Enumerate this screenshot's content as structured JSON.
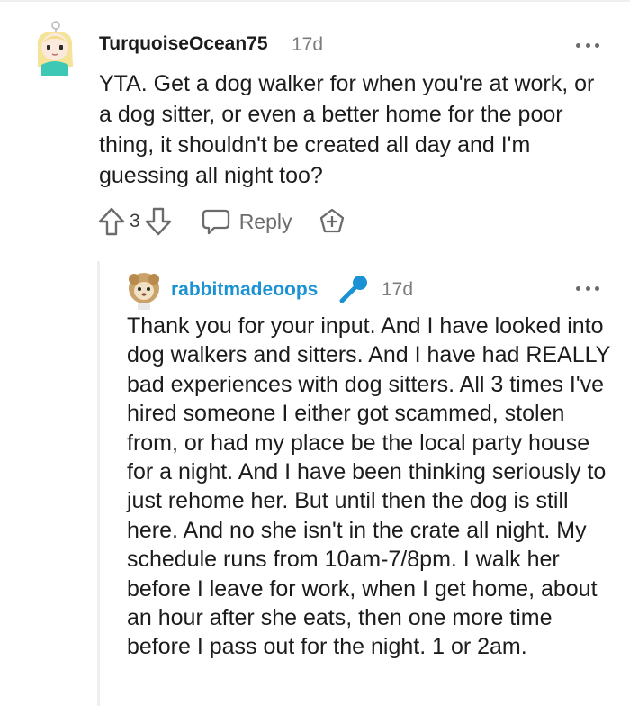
{
  "comments": [
    {
      "username": "TurquoiseOcean75",
      "time": "17d",
      "body": "YTA. Get a dog walker for when you're at work, or a dog sitter, or even a better home for the poor thing, it shouldn't be created all day and I'm guessing all night too?",
      "score": "3",
      "reply_label": "Reply"
    },
    {
      "username": "rabbitmadeoops",
      "time": "17d",
      "body": "Thank you for your input. And I have looked into dog walkers and sitters. And I have had REALLY bad experiences with dog sitters. All 3 times I've hired someone I either got scammed, stolen from, or had my place be the local party house for a night. And I have been thinking seriously to just rehome her. But until then the dog is still here. And no she isn't in the crate all night. My schedule runs from 10am-7/8pm. I walk her before I leave for work, when I get home, about an hour after she eats, then one more time before I pass out for the night. 1 or 2am."
    }
  ],
  "colors": {
    "username_primary": "#1c1c1c",
    "username_op": "#1a92d3",
    "meta": "#7c7c7c",
    "icon": "#6b6b6b",
    "thread_line": "#edeff1"
  },
  "icons": [
    "avatar",
    "more-options-icon",
    "upvote-icon",
    "downvote-icon",
    "reply-icon",
    "award-icon",
    "microphone-icon"
  ]
}
